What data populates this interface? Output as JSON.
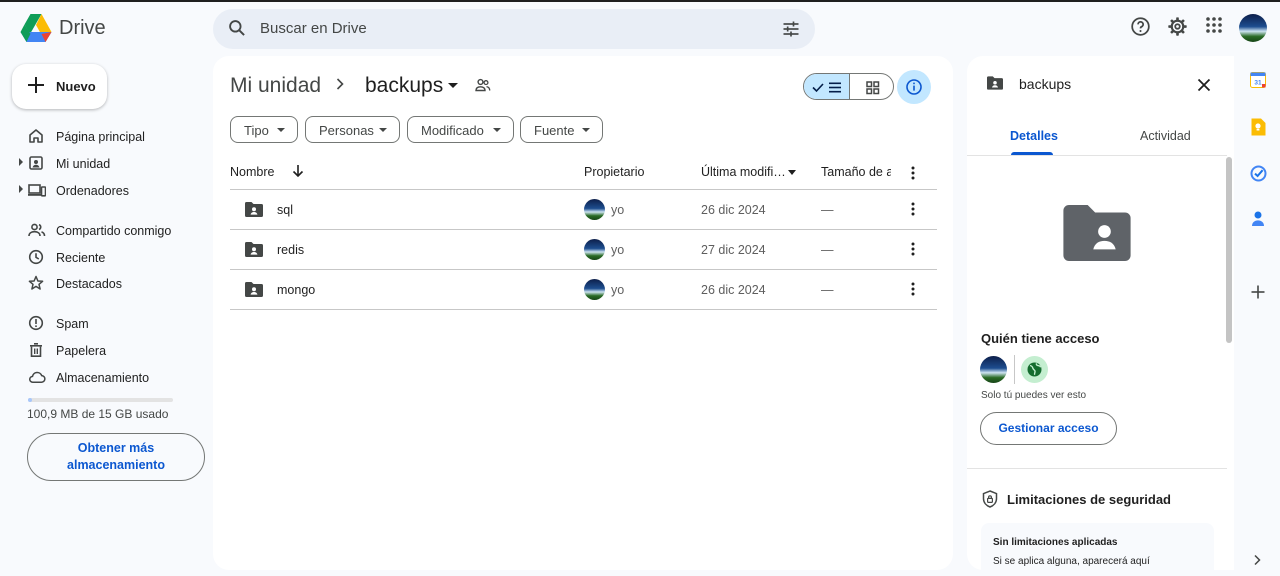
{
  "header": {
    "brand": "Drive",
    "search_placeholder": "Buscar en Drive"
  },
  "sidebar": {
    "new_label": "Nuevo",
    "items": [
      {
        "label": "Página principal",
        "icon": "home-icon"
      },
      {
        "label": "Mi unidad",
        "icon": "my-drive-icon"
      },
      {
        "label": "Ordenadores",
        "icon": "computers-icon"
      },
      {
        "label": "Compartido conmigo",
        "icon": "shared-icon"
      },
      {
        "label": "Reciente",
        "icon": "clock-icon"
      },
      {
        "label": "Destacados",
        "icon": "star-icon"
      },
      {
        "label": "Spam",
        "icon": "spam-icon"
      },
      {
        "label": "Papelera",
        "icon": "trash-icon"
      },
      {
        "label": "Almacenamiento",
        "icon": "cloud-icon"
      }
    ],
    "storage": {
      "used_fraction": 0.0067,
      "text": "100,9 MB de 15 GB usado"
    },
    "get_more_line1": "Obtener más",
    "get_more_line2": "almacenamiento"
  },
  "main": {
    "breadcrumb_root": "Mi unidad",
    "breadcrumb_current": "backups",
    "filters": [
      "Tipo",
      "Personas",
      "Modificado",
      "Fuente"
    ],
    "columns": {
      "name": "Nombre",
      "owner": "Propietario",
      "modified": "Última modifi…",
      "size": "Tamaño de a"
    },
    "rows": [
      {
        "name": "sql",
        "owner": "yo",
        "date": "26 dic 2024",
        "size": "—"
      },
      {
        "name": "redis",
        "owner": "yo",
        "date": "27 dic 2024",
        "size": "—"
      },
      {
        "name": "mongo",
        "owner": "yo",
        "date": "26 dic 2024",
        "size": "—"
      }
    ]
  },
  "details": {
    "title": "backups",
    "tab_details": "Detalles",
    "tab_activity": "Actividad",
    "access_title": "Quién tiene acceso",
    "access_note": "Solo tú puedes ver esto",
    "manage_label": "Gestionar acceso",
    "security_title": "Limitaciones de seguridad",
    "security_box_title": "Sin limitaciones aplicadas",
    "security_box_text": "Si se aplica alguna, aparecerá aquí"
  },
  "colors": {
    "accent": "#0b57d0",
    "selected_bg": "#c2e7ff",
    "search_bg": "#e9eef6",
    "page_bg": "#f8fafd"
  }
}
